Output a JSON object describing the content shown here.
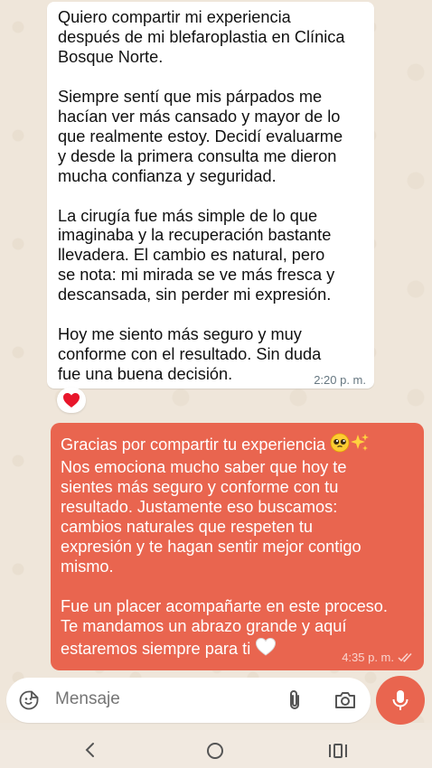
{
  "incoming_message": {
    "text": "Quiero compartir mi experiencia\ndespués de mi blefaroplastia en Clínica\nBosque Norte.\n\nSiempre sentí que mis párpados me\nhacían ver más cansado y mayor de lo\nque realmente estoy. Decidí evaluarme\ny desde la primera consulta me dieron\nmucha confianza y seguridad.\n\nLa cirugía fue más simple de lo que\nimaginaba y la recuperación bastante\nllevadera. El cambio es natural, pero\nse nota: mi mirada se ve más fresca y\ndescansada, sin perder mi expresión.\n\nHoy me siento más seguro y muy\nconforme con el resultado. Sin duda\nfue una buena decisión.",
    "time": "2:20 p. m.",
    "reaction": "❤️"
  },
  "outgoing_message": {
    "text_first_line": "Gracias por compartir tu experiencia ",
    "text_rest": "\nNos emociona mucho saber que hoy te\nsientes más seguro y conforme con tu\nresultado. Justamente eso buscamos:\ncambios naturales que respeten tu\nexpresión y te hagan sentir mejor contigo\nmismo.\n\nFue un placer acompañarte en este proceso.\nTe mandamos un abrazo grande y aquí\nestaremos siempre para ti ",
    "time": "4:35 p. m.",
    "bubble_color": "#e9654f"
  },
  "input_bar": {
    "placeholder": "Mensaje"
  },
  "colors": {
    "chat_background": "#efe6da",
    "accent": "#e9654f"
  }
}
